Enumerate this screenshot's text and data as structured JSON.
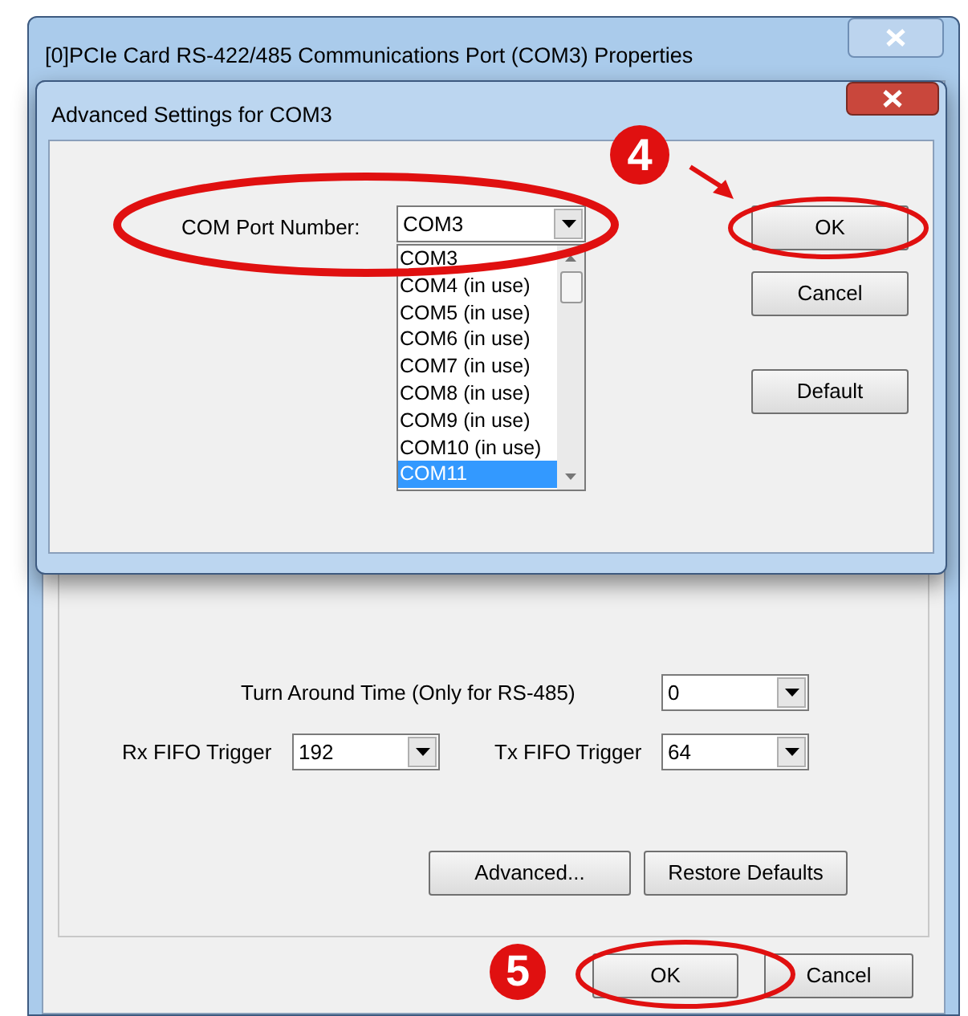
{
  "window": {
    "title": "[0]PCIe Card RS-422/485 Communications Port (COM3) Properties"
  },
  "dialog": {
    "title": "Advanced Settings for COM3",
    "com_port": {
      "label": "COM Port Number:",
      "value": "COM3",
      "options": [
        {
          "label": "COM3",
          "highlighted": false
        },
        {
          "label": "COM4 (in use)",
          "highlighted": false
        },
        {
          "label": "COM5 (in use)",
          "highlighted": false
        },
        {
          "label": "COM6 (in use)",
          "highlighted": false
        },
        {
          "label": "COM7 (in use)",
          "highlighted": false
        },
        {
          "label": "COM8 (in use)",
          "highlighted": false
        },
        {
          "label": "COM9 (in use)",
          "highlighted": false
        },
        {
          "label": "COM10 (in use)",
          "highlighted": false
        },
        {
          "label": "COM11",
          "highlighted": true
        }
      ]
    },
    "buttons": [
      "OK",
      "Cancel",
      "Default"
    ]
  },
  "settings": {
    "turn_around": {
      "label": "Turn Around Time (Only for RS-485)",
      "value": "0"
    },
    "rx_fifo": {
      "label": "Rx FIFO Trigger",
      "value": "192"
    },
    "tx_fifo": {
      "label": "Tx FIFO Trigger",
      "value": "64"
    }
  },
  "panel_buttons": [
    "Advanced...",
    "Restore Defaults"
  ],
  "buttons": [
    "OK",
    "Cancel"
  ],
  "annotations": [
    {
      "label": "4"
    },
    {
      "label": "5"
    }
  ]
}
